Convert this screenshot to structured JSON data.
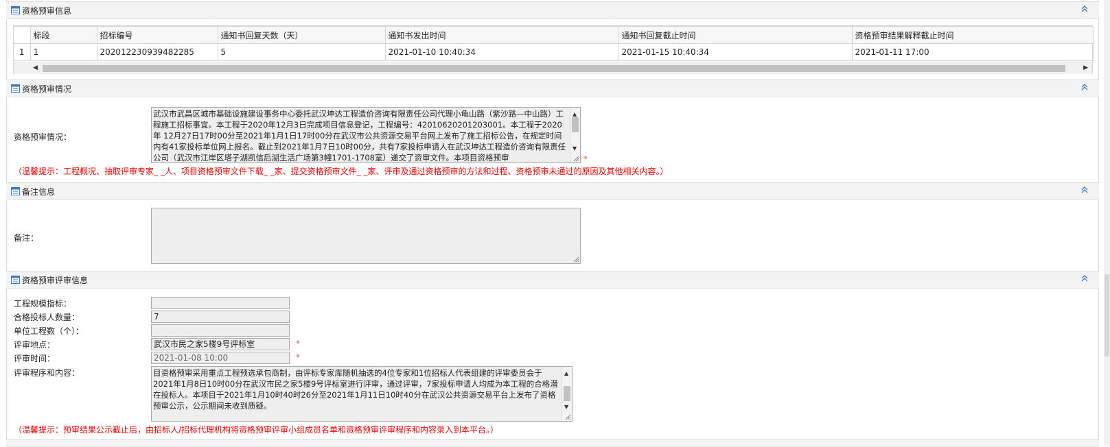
{
  "sections": {
    "qual_info": {
      "title": "资格预审信息"
    },
    "qual_situation": {
      "title": "资格预审情况"
    },
    "remarks": {
      "title": "备注信息"
    },
    "review_info": {
      "title": "资格预审评审信息"
    }
  },
  "grid": {
    "headers": [
      "标段",
      "招标编号",
      "通知书回复天数（天）",
      "通知书发出时间",
      "通知书回复截止时间",
      "资格预审结果解释截止时间"
    ],
    "rows": [
      {
        "row_no": "1",
        "cells": [
          "1",
          "202012230939482285",
          "5",
          "2021-01-10 10:40:34",
          "2021-01-15 10:40:34",
          "2021-01-11 17:00"
        ]
      }
    ]
  },
  "situation": {
    "label": "资格预审情况：",
    "text": "武汉市武昌区城市基础设施建设事务中心委托武汉坤达工程造价咨询有限责任公司代理小龟山路（紫沙路—中山路）工程施工招标事宜。本工程于2020年12月3日完成项目信息登记，工程编号：42010620201203001。本工程于2020年 12月27日17时00分至2021年1月1日17时00分在武汉市公共资源交易平台网上发布了施工招标公告，在规定时间内有41家投标单位网上报名。截止到2021年1月7日10时00分，共有7家投标申请人在武汉坤达工程造价咨询有限责任公司（武汉市江岸区塔子湖凯信后湖生活广场第3幢1701-1708室）递交了资审文件。本项目资格预审",
    "required_mark": "*",
    "tip": "（温馨提示：工程概况、抽取评审专家_ _人、项目资格预审文件下载_ _家、提交资格预审文件_ _家、评审及通过资格预审的方法和过程、资格预审未通过的原因及其他相关内容。）"
  },
  "remarks": {
    "label": "备注：",
    "value": ""
  },
  "review": {
    "fields": [
      {
        "label": "工程规模指标：",
        "value": ""
      },
      {
        "label": "合格投标人数量：",
        "value": "7"
      },
      {
        "label": "单位工程数（个）：",
        "value": ""
      },
      {
        "label": "评审地点：",
        "value": "武汉市民之家5楼9号评标室",
        "required": "*"
      },
      {
        "label": "评审时间：",
        "value": "2021-01-08 10:00",
        "required": "*"
      }
    ],
    "process_label": "评审程序和内容：",
    "process_text": "目资格预审采用重点工程预选承包商制，由评标专家库随机抽选的4位专家和1位招标人代表组建的评审委员会于2021年1月8日10时00分在武汉市民之家5楼9号评标室进行评审，通过评审，7家投标申请人均成为本工程的合格潜在投标人。本项目于2021年1月10时40时26分至2021年1月11日10时40分在武汉公共资源交易平台上发布了资格预审公示，公示期间未收到质疑。",
    "tip": "（温馨提示：预审结果公示截止后，由招标人/招标代理机构将资格预审评审小组成员名单和资格预审评审程序和内容录入到本平台。）"
  },
  "colors": {
    "header_bg": "#f3f3f3",
    "icon_blue": "#3a78c9",
    "tip_red": "#ee0000",
    "required": "#f15a24"
  }
}
